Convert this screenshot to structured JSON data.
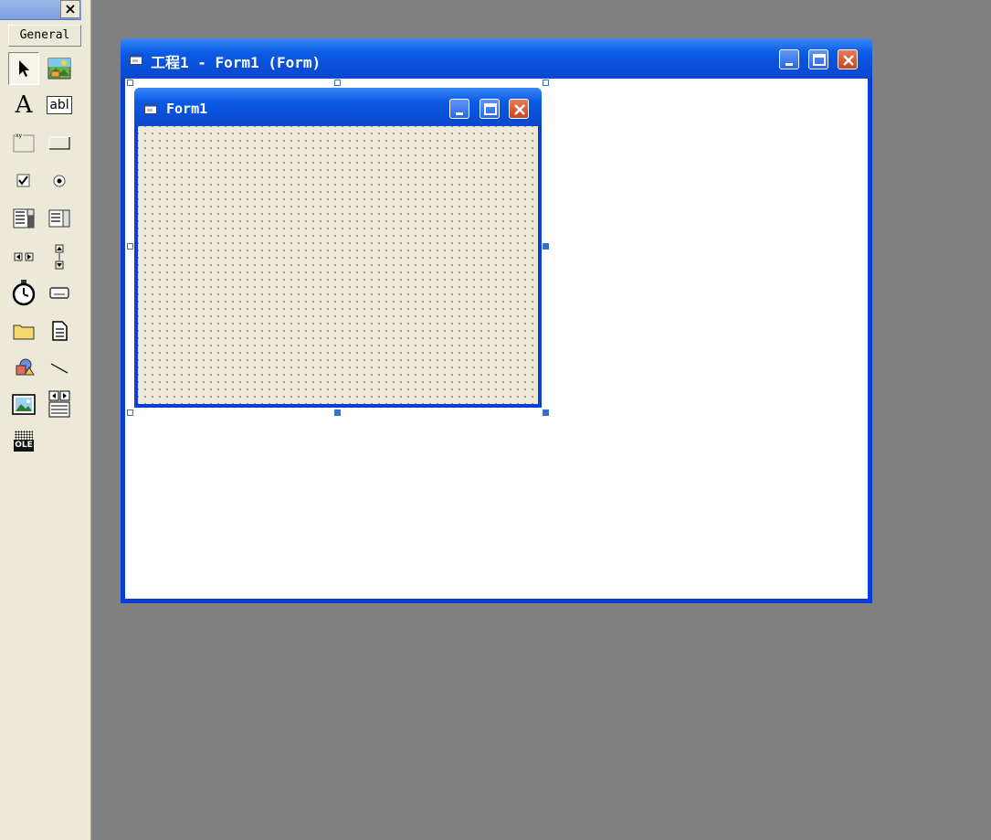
{
  "toolbox": {
    "close_glyph": "×",
    "tab_label": "General",
    "tools": [
      {
        "name": "pointer",
        "icon": "pointer-icon"
      },
      {
        "name": "picturebox",
        "icon": "picturebox-icon"
      },
      {
        "name": "label",
        "icon": "label-icon",
        "glyph": "A"
      },
      {
        "name": "textbox",
        "icon": "textbox-icon",
        "glyph": "abl"
      },
      {
        "name": "frame",
        "icon": "frame-icon"
      },
      {
        "name": "commandbutton",
        "icon": "commandbutton-icon"
      },
      {
        "name": "checkbox",
        "icon": "checkbox-icon"
      },
      {
        "name": "optionbutton",
        "icon": "optionbutton-icon"
      },
      {
        "name": "combobox",
        "icon": "combobox-icon"
      },
      {
        "name": "listbox",
        "icon": "listbox-icon"
      },
      {
        "name": "hscrollbar",
        "icon": "hscrollbar-icon"
      },
      {
        "name": "vscrollbar",
        "icon": "vscrollbar-icon"
      },
      {
        "name": "timer",
        "icon": "timer-icon"
      },
      {
        "name": "drivelistbox",
        "icon": "drivelistbox-icon"
      },
      {
        "name": "dirlistbox",
        "icon": "dirlistbox-icon"
      },
      {
        "name": "filelistbox",
        "icon": "filelistbox-icon"
      },
      {
        "name": "shape",
        "icon": "shape-icon"
      },
      {
        "name": "line",
        "icon": "line-icon"
      },
      {
        "name": "image",
        "icon": "image-icon"
      },
      {
        "name": "data",
        "icon": "data-icon"
      },
      {
        "name": "ole",
        "icon": "ole-icon",
        "glyph": "OLE"
      }
    ]
  },
  "outer_window": {
    "title": "工程1 - Form1 (Form)"
  },
  "form": {
    "title": "Form1"
  },
  "colors": {
    "titlebar": "#0a4fd8",
    "desktop": "#808080",
    "form_back": "#ece9d8",
    "handle": "#3a6fc6"
  }
}
